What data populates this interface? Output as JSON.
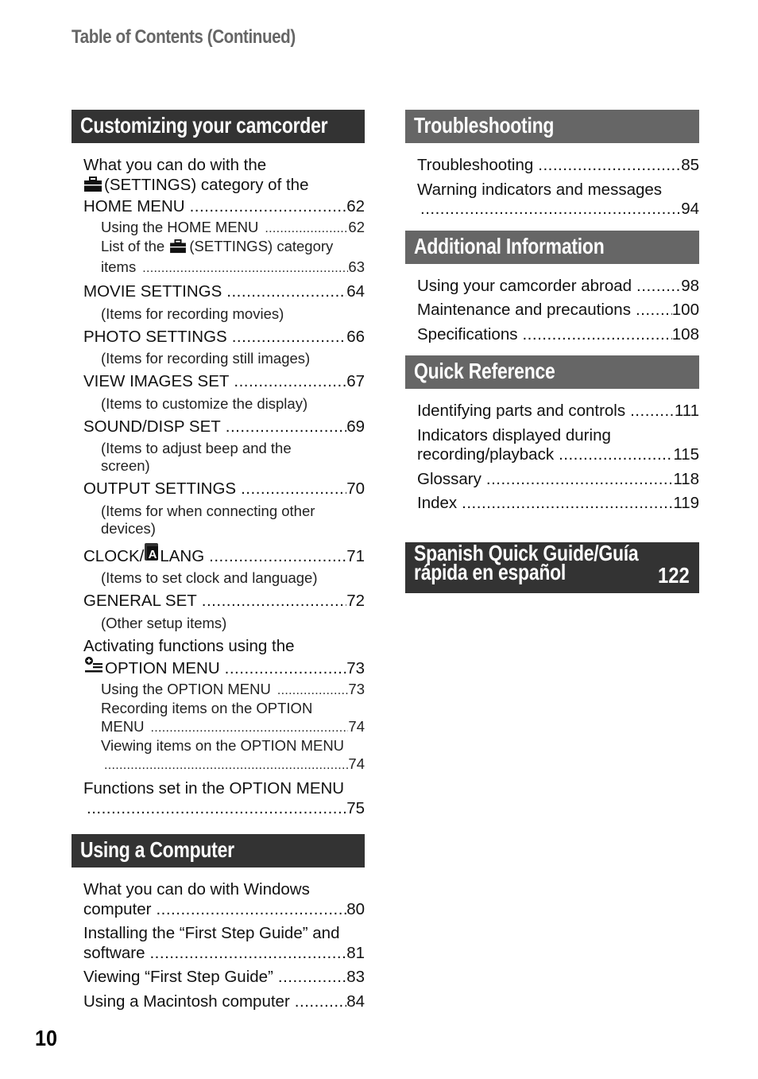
{
  "running_head": "Table of Contents (Continued)",
  "page_number": "10",
  "colors": {
    "header_dark": "#333333",
    "header_mid": "#666666",
    "running_head": "#666666"
  },
  "left": {
    "customizing": {
      "title": "Customizing your camcorder",
      "entries": [
        {
          "lines": [
            "What you can do with the",
            "(SETTINGS) category of the",
            "HOME MENU"
          ],
          "icon": "toolbox-icon",
          "page": "62",
          "subs": [
            {
              "text": "Using the HOME MENU",
              "page": "62"
            },
            {
              "lines": [
                "List of the",
                "(SETTINGS) category",
                "items"
              ],
              "icon": "toolbox-icon",
              "page": "63"
            }
          ]
        },
        {
          "text": "MOVIE SETTINGS",
          "page": "64",
          "note": "(Items for recording movies)"
        },
        {
          "text": "PHOTO SETTINGS",
          "page": "66",
          "note": "(Items for recording still images)"
        },
        {
          "text": "VIEW IMAGES SET",
          "page": "67",
          "note": "(Items to customize the display)"
        },
        {
          "text": "SOUND/DISP SET",
          "page": "69",
          "note": "(Items to adjust beep and the screen)"
        },
        {
          "text": "OUTPUT SETTINGS",
          "page": "70",
          "note": "(Items for when connecting other devices)"
        },
        {
          "text_before": "CLOCK/",
          "icon": "language-a-icon",
          "text_after": "LANG",
          "page": "71",
          "note": "(Items to set clock and language)"
        },
        {
          "text": "GENERAL SET",
          "page": "72",
          "note": "(Other setup items)"
        },
        {
          "lines": [
            "Activating functions using the",
            "OPTION MENU"
          ],
          "icon": "option-menu-icon",
          "page": "73",
          "subs": [
            {
              "text": "Using the OPTION MENU",
              "page": "73"
            },
            {
              "lines": [
                "Recording items on the OPTION",
                "MENU"
              ],
              "page": "74"
            },
            {
              "lines": [
                "Viewing items on the OPTION MENU",
                ""
              ],
              "page": "74"
            }
          ]
        },
        {
          "lines": [
            "Functions set in the OPTION MENU",
            ""
          ],
          "page": "75"
        }
      ]
    },
    "computer": {
      "title": "Using a Computer",
      "entries": [
        {
          "lines": [
            "What you can do with Windows",
            "computer"
          ],
          "page": "80"
        },
        {
          "lines": [
            "Installing the “First Step Guide” and",
            "software"
          ],
          "page": "81"
        },
        {
          "text": "Viewing “First Step Guide”",
          "page": "83"
        },
        {
          "text": "Using a Macintosh computer",
          "page": "84"
        }
      ]
    }
  },
  "right": {
    "troubleshooting": {
      "title": "Troubleshooting",
      "entries": [
        {
          "text": "Troubleshooting",
          "page": "85"
        },
        {
          "lines": [
            "Warning indicators and messages",
            ""
          ],
          "page": "94"
        }
      ]
    },
    "additional": {
      "title": "Additional Information",
      "entries": [
        {
          "text": "Using your camcorder abroad",
          "page": "98"
        },
        {
          "text": "Maintenance and precautions",
          "page": "100"
        },
        {
          "text": "Specifications",
          "page": "108"
        }
      ]
    },
    "quickref": {
      "title": "Quick Reference",
      "entries": [
        {
          "text": "Identifying parts and controls",
          "page": "111"
        },
        {
          "lines": [
            "Indicators displayed during",
            "recording/playback"
          ],
          "page": "115"
        },
        {
          "text": "Glossary",
          "page": "118"
        },
        {
          "text": "Index",
          "page": "119"
        }
      ]
    },
    "spanish": {
      "line1": "Spanish Quick Guide/Guía",
      "line2": "rápida en español",
      "page": "122"
    }
  }
}
